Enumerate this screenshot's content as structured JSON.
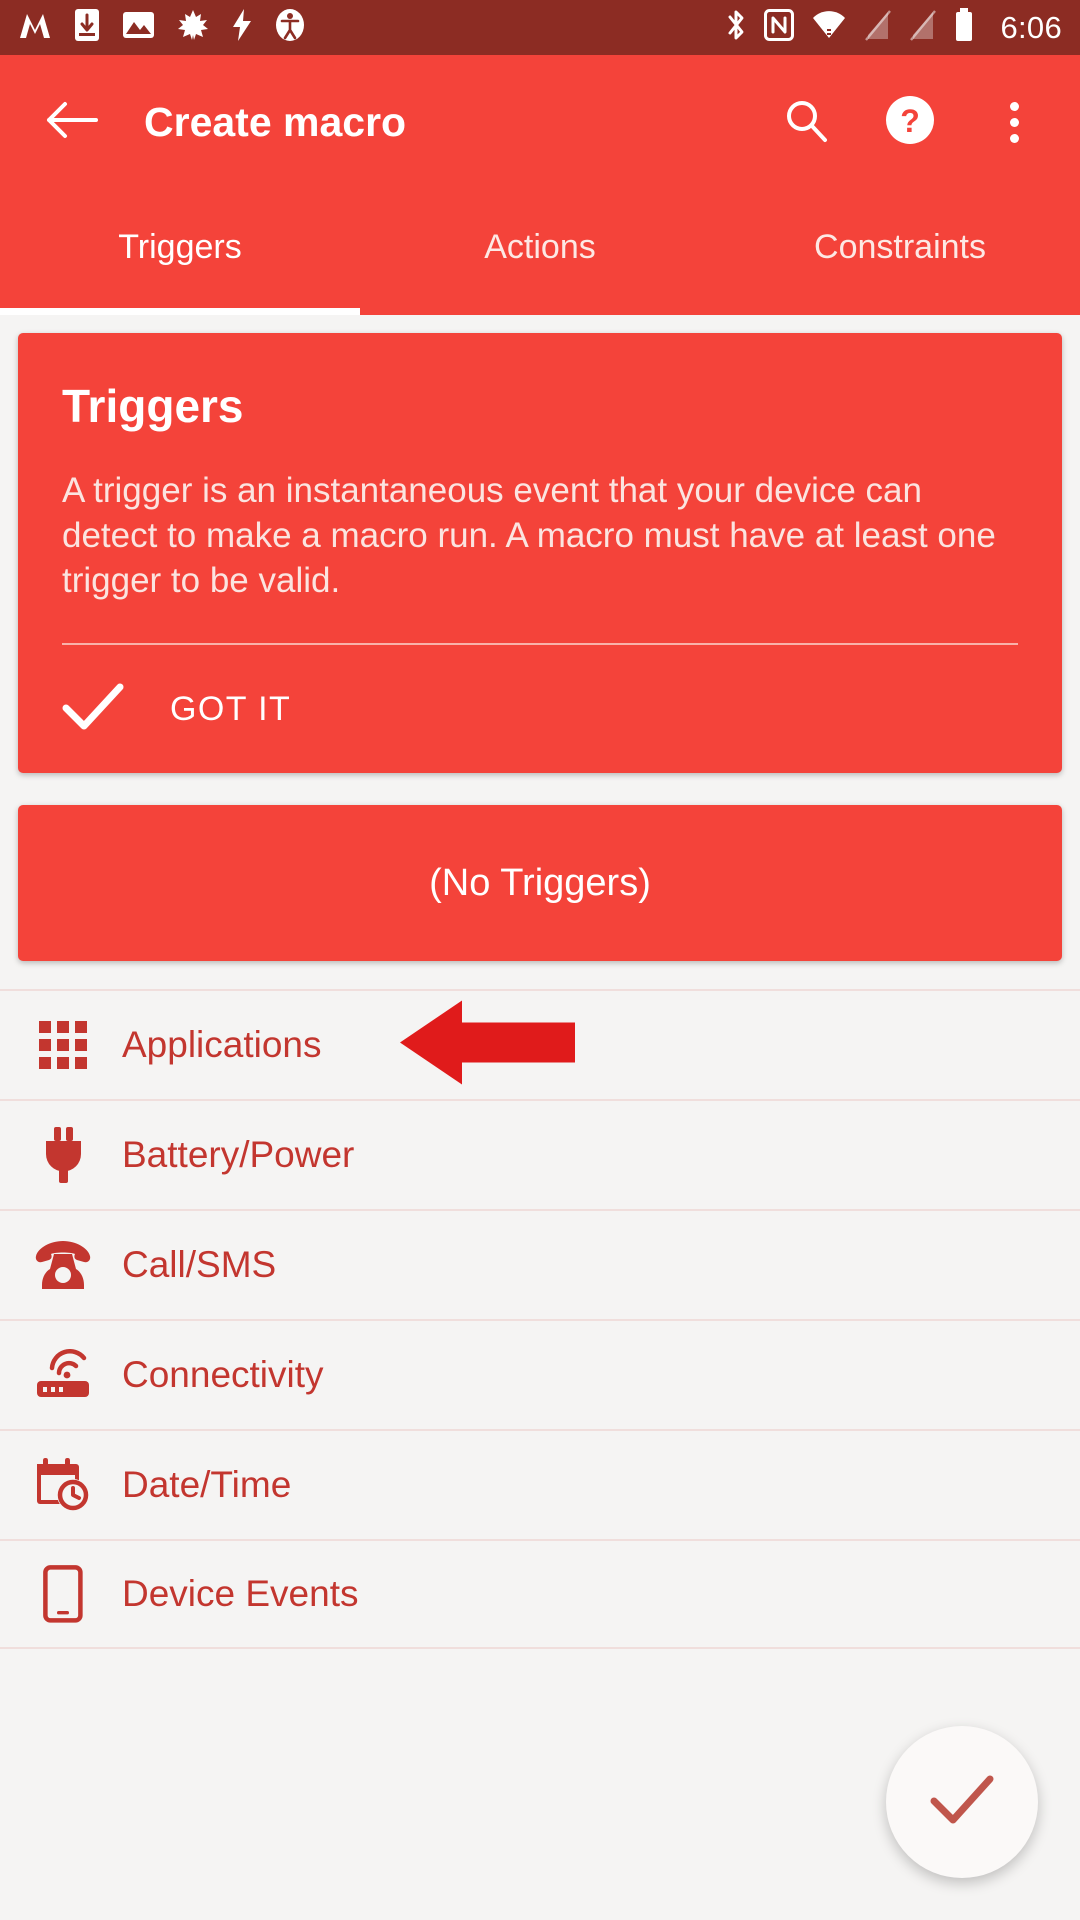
{
  "status_bar": {
    "time": "6:06",
    "left_icons": [
      {
        "name": "monotype-m-icon"
      },
      {
        "name": "download-to-phone-icon"
      },
      {
        "name": "screenshot-image-icon"
      },
      {
        "name": "maple-leaf-icon"
      },
      {
        "name": "flash-bolt-icon"
      },
      {
        "name": "accessibility-icon"
      }
    ],
    "right_icons": [
      {
        "name": "bluetooth-icon"
      },
      {
        "name": "nfc-icon"
      },
      {
        "name": "wifi-icon"
      },
      {
        "name": "sim1-no-signal-icon"
      },
      {
        "name": "sim2-no-signal-icon"
      },
      {
        "name": "battery-icon"
      }
    ]
  },
  "app_bar": {
    "title": "Create macro",
    "back_icon": "back-arrow-icon",
    "search_icon": "search-icon",
    "help_icon": "help-circle-icon",
    "overflow_icon": "overflow-menu-icon"
  },
  "tabs": [
    {
      "label": "Triggers",
      "active": true
    },
    {
      "label": "Actions",
      "active": false
    },
    {
      "label": "Constraints",
      "active": false
    }
  ],
  "info_card": {
    "title": "Triggers",
    "body": "A trigger is an instantaneous event that your device can detect to make a macro run. A macro must have at least one trigger to be valid.",
    "action_label": "GOT IT",
    "action_icon": "check-icon"
  },
  "no_triggers_button": {
    "label": "(No Triggers)"
  },
  "trigger_categories": [
    {
      "label": "Applications",
      "icon": "apps-grid-icon",
      "annotated": true
    },
    {
      "label": "Battery/Power",
      "icon": "power-plug-icon",
      "annotated": false
    },
    {
      "label": "Call/SMS",
      "icon": "telephone-icon",
      "annotated": false
    },
    {
      "label": "Connectivity",
      "icon": "router-wifi-icon",
      "annotated": false
    },
    {
      "label": "Date/Time",
      "icon": "calendar-clock-icon",
      "annotated": false
    },
    {
      "label": "Device Events",
      "icon": "smartphone-icon",
      "annotated": false
    }
  ],
  "annotation": {
    "type": "arrow",
    "direction": "left",
    "color": "#e01b1b",
    "points_at": "Applications"
  },
  "fab": {
    "icon": "check-icon",
    "label": "Confirm"
  },
  "colors": {
    "primary": "#f4433a",
    "status_bar": "#8c2c23",
    "list_text": "#c3362f",
    "background": "#f5f4f3",
    "annotation_red": "#e01b1b"
  }
}
